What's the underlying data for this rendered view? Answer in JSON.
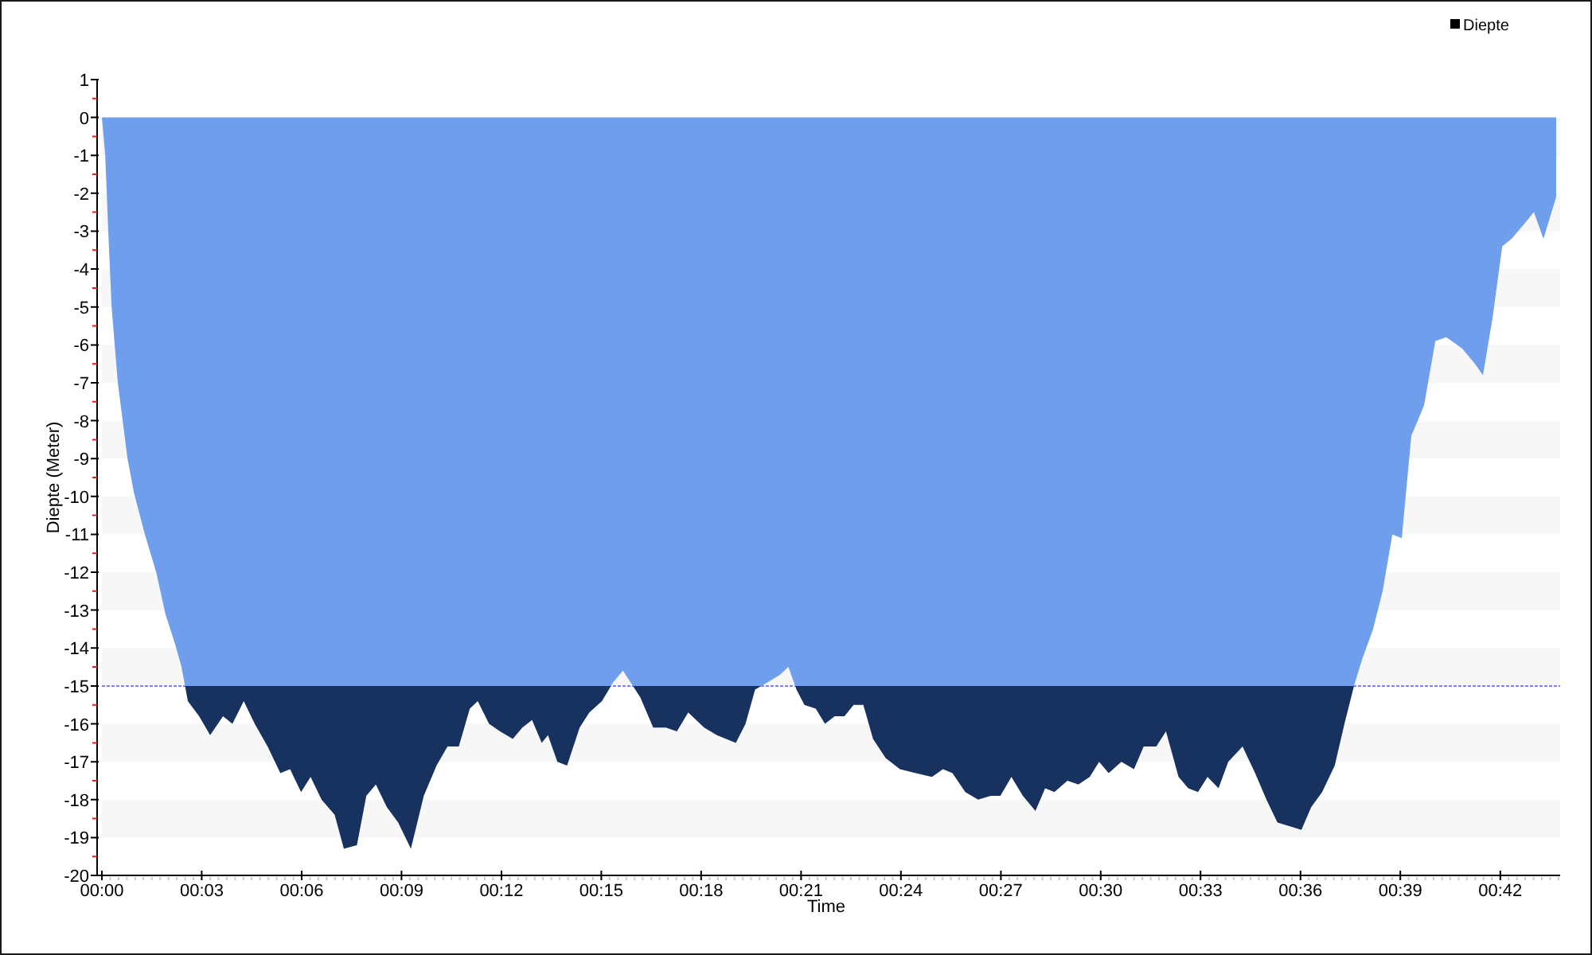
{
  "chart": {
    "chart_data": {
      "type": "area",
      "xlabel": "Time",
      "ylabel": "Diepte (Meter)",
      "x": [
        0,
        0.1,
        0.19,
        0.29,
        0.48,
        0.77,
        0.96,
        1.29,
        1.63,
        1.91,
        2.2,
        2.39,
        2.58,
        2.92,
        3.25,
        3.64,
        3.92,
        4.26,
        4.59,
        4.98,
        5.36,
        5.65,
        5.98,
        6.27,
        6.6,
        6.99,
        7.27,
        7.66,
        7.94,
        8.23,
        8.56,
        8.9,
        9.28,
        9.67,
        10.05,
        10.38,
        10.72,
        11.05,
        11.29,
        11.63,
        11.96,
        12.34,
        12.63,
        12.92,
        13.21,
        13.4,
        13.68,
        13.97,
        14.35,
        14.64,
        15.02,
        15.36,
        15.65,
        16.17,
        16.56,
        16.94,
        17.27,
        17.61,
        18.09,
        18.47,
        19.04,
        19.33,
        19.62,
        20.0,
        20.38,
        20.62,
        20.86,
        21.1,
        21.44,
        21.72,
        22.01,
        22.3,
        22.58,
        22.87,
        23.16,
        23.54,
        23.97,
        24.45,
        24.93,
        25.26,
        25.55,
        25.93,
        26.32,
        26.7,
        26.99,
        27.32,
        27.66,
        28.04,
        28.33,
        28.61,
        29.0,
        29.33,
        29.67,
        29.95,
        30.24,
        30.62,
        31.0,
        31.29,
        31.67,
        31.96,
        32.34,
        32.63,
        32.92,
        33.21,
        33.54,
        33.83,
        34.26,
        34.64,
        34.98,
        35.31,
        36.03,
        36.32,
        36.65,
        37.03,
        37.32,
        37.61,
        37.85,
        38.18,
        38.47,
        38.76,
        39.04,
        39.33,
        39.71,
        40.05,
        40.38,
        40.86,
        41.24,
        41.48,
        41.77,
        42.06,
        42.34,
        42.73,
        43.01,
        43.3,
        43.68
      ],
      "series": [
        {
          "name": "Diepte",
          "color": "#6f9fec",
          "values": [
            0,
            -1.0,
            -3.0,
            -5.0,
            -7.0,
            -9.0,
            -9.9,
            -11.0,
            -12.0,
            -13.1,
            -13.9,
            -14.5,
            -15.4,
            -15.8,
            -16.3,
            -15.8,
            -16.0,
            -15.4,
            -16.0,
            -16.6,
            -17.3,
            -17.2,
            -17.8,
            -17.4,
            -18.0,
            -18.4,
            -19.3,
            -19.2,
            -17.9,
            -17.6,
            -18.2,
            -18.6,
            -19.3,
            -17.9,
            -17.1,
            -16.6,
            -16.6,
            -15.6,
            -15.4,
            -16.0,
            -16.2,
            -16.4,
            -16.1,
            -15.9,
            -16.5,
            -16.3,
            -17.0,
            -17.1,
            -16.1,
            -15.7,
            -15.4,
            -14.9,
            -14.6,
            -15.3,
            -16.1,
            -16.1,
            -16.2,
            -15.7,
            -16.1,
            -16.3,
            -16.5,
            -16.0,
            -15.1,
            -14.9,
            -14.7,
            -14.5,
            -15.1,
            -15.5,
            -15.6,
            -16.0,
            -15.8,
            -15.8,
            -15.5,
            -15.5,
            -16.4,
            -16.9,
            -17.2,
            -17.3,
            -17.4,
            -17.2,
            -17.3,
            -17.8,
            -18.0,
            -17.9,
            -17.9,
            -17.4,
            -17.9,
            -18.3,
            -17.7,
            -17.8,
            -17.5,
            -17.6,
            -17.4,
            -17.0,
            -17.3,
            -17.0,
            -17.2,
            -16.6,
            -16.6,
            -16.2,
            -17.4,
            -17.7,
            -17.8,
            -17.4,
            -17.7,
            -17.0,
            -16.6,
            -17.3,
            -18.0,
            -18.6,
            -18.8,
            -18.2,
            -17.8,
            -17.1,
            -16.0,
            -15.0,
            -14.3,
            -13.5,
            -12.5,
            -11.0,
            -11.1,
            -8.4,
            -7.6,
            -5.9,
            -5.8,
            -6.1,
            -6.5,
            -6.8,
            -5.3,
            -3.4,
            -3.2,
            -2.8,
            -2.5,
            -3.2,
            -2.1
          ]
        }
      ],
      "xlim": [
        0,
        43.8
      ],
      "ylim": [
        -20,
        1
      ],
      "xticks": [
        {
          "value": 0,
          "label": "00:00"
        },
        {
          "value": 3,
          "label": "00:03"
        },
        {
          "value": 6,
          "label": "00:06"
        },
        {
          "value": 9,
          "label": "00:09"
        },
        {
          "value": 12,
          "label": "00:12"
        },
        {
          "value": 15,
          "label": "00:15"
        },
        {
          "value": 18,
          "label": "00:18"
        },
        {
          "value": 21,
          "label": "00:21"
        },
        {
          "value": 24,
          "label": "00:24"
        },
        {
          "value": 27,
          "label": "00:27"
        },
        {
          "value": 30,
          "label": "00:30"
        },
        {
          "value": 33,
          "label": "00:33"
        },
        {
          "value": 36,
          "label": "00:36"
        },
        {
          "value": 39,
          "label": "00:39"
        },
        {
          "value": 42,
          "label": "00:42"
        }
      ],
      "yticks": [
        1,
        0,
        -1,
        -2,
        -3,
        -4,
        -5,
        -6,
        -7,
        -8,
        -9,
        -10,
        -11,
        -12,
        -13,
        -14,
        -15,
        -16,
        -17,
        -18,
        -19,
        -20
      ],
      "ref_lines": [
        {
          "axis": "y",
          "value": -15,
          "color": "#8080ff"
        }
      ]
    }
  }
}
